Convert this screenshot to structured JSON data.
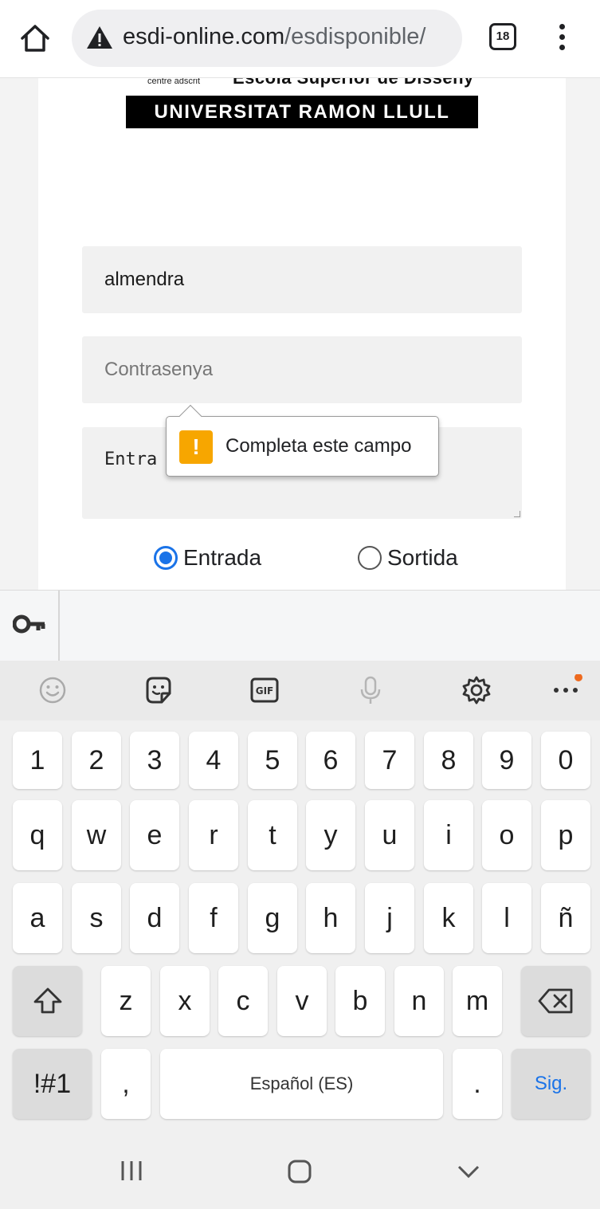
{
  "browser": {
    "url_domain": "esdi-online.com",
    "url_path": "/esdisponible/",
    "tab_count": "18",
    "home_icon": "home-icon",
    "warning_icon": "warning-triangle-icon",
    "menu_icon": "overflow-menu-icon"
  },
  "page": {
    "logo": {
      "sub_left": "centre adscrit",
      "sub_right": "Escola Superior de Disseny",
      "university": "UNIVERSITAT RAMON LLULL"
    },
    "form": {
      "username_value": "almendra",
      "password_placeholder": "Contrasenya",
      "note_value": "Entra",
      "validation_message": "Completa este campo",
      "radio_options": [
        {
          "label": "Entrada",
          "checked": true
        },
        {
          "label": "Sortida",
          "checked": false
        }
      ]
    }
  },
  "keyboard": {
    "autofill_icon": "key-icon",
    "toolbar_icons": [
      "emoji-icon",
      "sticker-icon",
      "gif-icon",
      "microphone-icon",
      "settings-icon",
      "more-icon"
    ],
    "row1": [
      "1",
      "2",
      "3",
      "4",
      "5",
      "6",
      "7",
      "8",
      "9",
      "0"
    ],
    "row2": [
      "q",
      "w",
      "e",
      "r",
      "t",
      "y",
      "u",
      "i",
      "o",
      "p"
    ],
    "row3": [
      "a",
      "s",
      "d",
      "f",
      "g",
      "h",
      "j",
      "k",
      "l",
      "ñ"
    ],
    "row4": [
      "z",
      "x",
      "c",
      "v",
      "b",
      "n",
      "m"
    ],
    "symbols_label": "!#1",
    "comma_label": ",",
    "space_label": "Español (ES)",
    "period_label": ".",
    "next_label": "Sig."
  },
  "nav": {
    "recents_icon": "recents-icon",
    "home_icon": "home-button-icon",
    "back_icon": "back-chevron-icon"
  }
}
